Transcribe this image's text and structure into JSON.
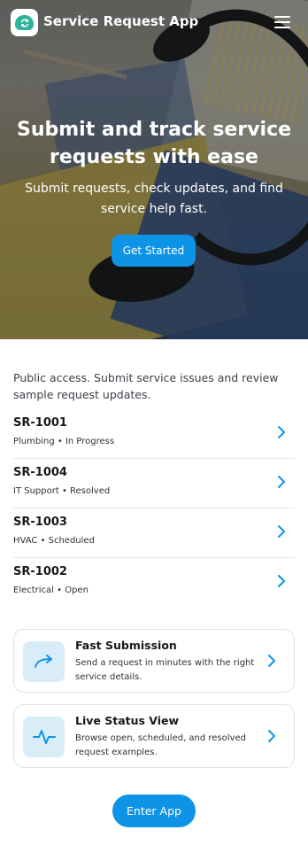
{
  "header": {
    "app_title": "Service Request App",
    "logo_icon": "cloud-sync-icon",
    "menu_icon": "hamburger-menu-icon"
  },
  "hero": {
    "title": "Submit and track service requests with ease",
    "subtitle": "Submit requests, check updates, and find service help fast.",
    "cta_label": "Get Started"
  },
  "intro_text": "Public access. Submit service issues and review sample request updates.",
  "requests": [
    {
      "id": "SR-1001",
      "meta": "Plumbing • In Progress"
    },
    {
      "id": "SR-1004",
      "meta": "IT Support • Resolved"
    },
    {
      "id": "SR-1003",
      "meta": "HVAC • Scheduled"
    },
    {
      "id": "SR-1002",
      "meta": "Electrical • Open"
    }
  ],
  "features": [
    {
      "title": "Fast Submission",
      "description": "Send a request in minutes with the right service details.",
      "icon": "arrow-forward-icon"
    },
    {
      "title": "Live Status View",
      "description": "Browse open, scheduled, and resolved request examples.",
      "icon": "pulse-icon"
    }
  ],
  "enter_app_label": "Enter App",
  "colors": {
    "accent": "#0e94e6",
    "logo_green": "#2fb39d",
    "icon_bg": "#d9edf9"
  }
}
